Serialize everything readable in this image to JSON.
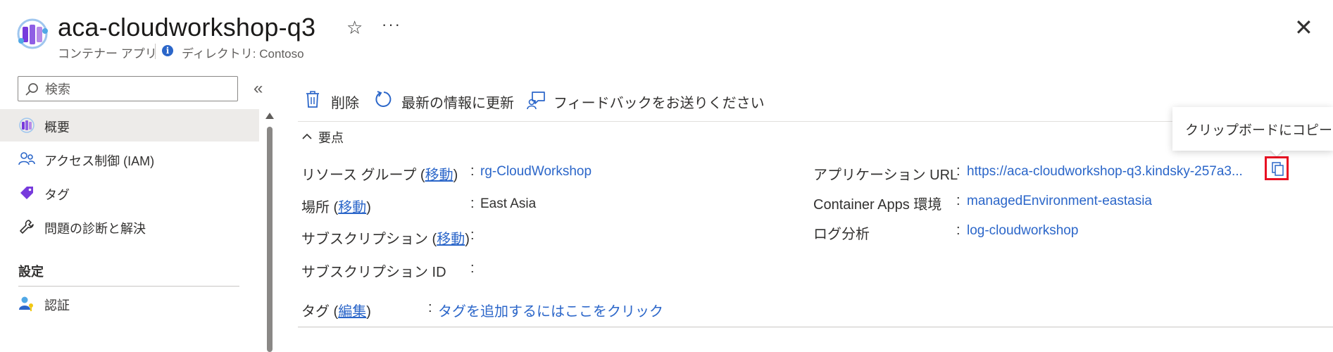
{
  "header": {
    "title": "aca-cloudworkshop-q3",
    "subtitle": "コンテナー アプリ",
    "directory": "ディレクトリ: Contoso",
    "favorite_icon": "star-icon",
    "more_icon": "ellipsis-icon",
    "close_icon": "close-icon",
    "more_glyph": "···",
    "close_glyph": "✕",
    "star_glyph": "☆"
  },
  "sidebar": {
    "search_placeholder": "検索",
    "collapse_glyph": "«",
    "items": [
      {
        "label": "概要",
        "icon": "container-app-icon"
      },
      {
        "label": "アクセス制御 (IAM)",
        "icon": "people-icon"
      },
      {
        "label": "タグ",
        "icon": "tag-icon"
      },
      {
        "label": "問題の診断と解決",
        "icon": "wrench-icon"
      }
    ],
    "section_settings": "設定",
    "settings_items": [
      {
        "label": "認証",
        "icon": "user-key-icon"
      }
    ]
  },
  "toolbar": {
    "delete_label": "削除",
    "refresh_label": "最新の情報に更新",
    "feedback_label": "フィードバックをお送りください"
  },
  "essentials": {
    "toggle_label": "要点",
    "left": {
      "resource_group_label": "リソース グループ (",
      "resource_group_move": "移動",
      "resource_group_close": ")",
      "resource_group_value": "rg-CloudWorkshop",
      "location_label": "場所 (",
      "location_move": "移動",
      "location_close": ")",
      "location_value": "East Asia",
      "subscription_label": "サブスクリプション (",
      "subscription_move": "移動",
      "subscription_close": ")",
      "subscription_id_label": "サブスクリプション ID",
      "tags_label": "タグ (",
      "tags_edit": "編集",
      "tags_close": ")",
      "tags_value": "タグを追加するにはここをクリック"
    },
    "right": {
      "app_url_label": "アプリケーション URL",
      "app_url_value": "https://aca-cloudworkshop-q3.kindsky-257a3...",
      "env_label": "Container Apps 環境",
      "env_value": "managedEnvironment-eastasia",
      "log_label": "ログ分析",
      "log_value": "log-cloudworkshop"
    },
    "colon": ":"
  },
  "tooltip": {
    "text": "クリップボードにコピー"
  },
  "colors": {
    "link": "#2b66c9",
    "highlight_border": "#e81123",
    "active_nav": "#edebe9"
  }
}
